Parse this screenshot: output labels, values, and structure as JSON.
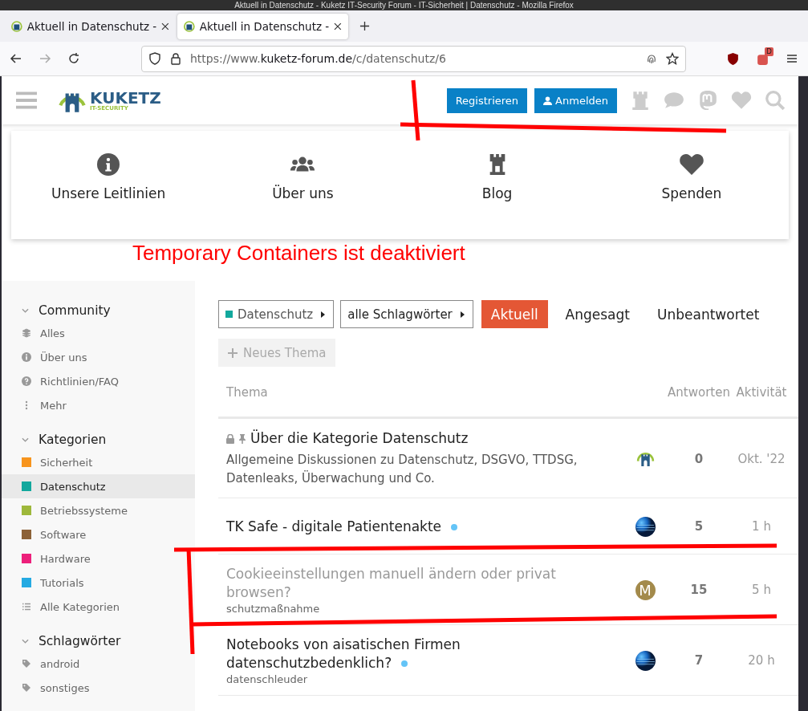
{
  "window": {
    "title": "Aktuell in Datenschutz - Kuketz IT-Security Forum - IT-Sicherheit | Datenschutz - Mozilla Firefox"
  },
  "browser_tabs": [
    {
      "label": "Aktuell in Datenschutz -",
      "selected": false
    },
    {
      "label": "Aktuell in Datenschutz -",
      "selected": true
    }
  ],
  "address_bar": {
    "url_prefix": "https://www.",
    "url_domain": "kuketz-forum.de",
    "url_path": "/c/datenschutz/6",
    "extension_badge": "D"
  },
  "site_header": {
    "logo_text": "KUKETZ",
    "logo_subtext": "IT-SECURITY",
    "buttons": [
      {
        "label": "Registrieren",
        "kind": "signup"
      },
      {
        "label": "Anmelden",
        "kind": "login"
      }
    ]
  },
  "quick_links": [
    {
      "label": "Unsere Leitlinien",
      "kind": "info"
    },
    {
      "label": "Über uns",
      "kind": "users"
    },
    {
      "label": "Blog",
      "kind": "tower"
    },
    {
      "label": "Spenden",
      "kind": "heart"
    }
  ],
  "annotation": {
    "text": "Temporary Containers ist deaktiviert"
  },
  "sidebar": {
    "sections": [
      {
        "title": "Community",
        "expanded": true,
        "items": [
          {
            "label": "Alles",
            "kind": "layers",
            "selected": false
          },
          {
            "label": "Über uns",
            "kind": "info",
            "selected": false
          },
          {
            "label": "Richtlinien/FAQ",
            "kind": "question",
            "selected": false
          },
          {
            "label": "Mehr",
            "kind": "more",
            "selected": false
          }
        ]
      },
      {
        "title": "Kategorien",
        "expanded": true,
        "items": [
          {
            "label": "Sicherheit",
            "kind": "category",
            "color": "#f7941d",
            "selected": false
          },
          {
            "label": "Datenschutz",
            "kind": "category",
            "color": "#12a89d",
            "selected": true
          },
          {
            "label": "Betriebssysteme",
            "kind": "category",
            "color": "#9eb83b",
            "selected": false
          },
          {
            "label": "Software",
            "kind": "category",
            "color": "#8c6238",
            "selected": false
          },
          {
            "label": "Hardware",
            "kind": "category",
            "color": "#ed207b",
            "selected": false
          },
          {
            "label": "Tutorials",
            "kind": "category",
            "color": "#25aae2",
            "selected": false
          },
          {
            "label": "Alle Kategorien",
            "kind": "list",
            "selected": false
          }
        ]
      },
      {
        "title": "Schlagwörter",
        "expanded": true,
        "items": [
          {
            "label": "android",
            "kind": "tag",
            "selected": false
          },
          {
            "label": "sonstiges",
            "kind": "tag",
            "selected": false
          }
        ]
      }
    ]
  },
  "filters": {
    "category": {
      "label": "Datenschutz",
      "color": "#12a89d"
    },
    "tags": {
      "label": "alle Schlagwörter"
    }
  },
  "nav_tabs": [
    {
      "label": "Aktuell",
      "selected": true
    },
    {
      "label": "Angesagt",
      "selected": false
    },
    {
      "label": "Unbeantwortet",
      "selected": false
    }
  ],
  "new_topic_button": {
    "label": "Neues Thema",
    "disabled": true
  },
  "table": {
    "columns": [
      "Thema",
      "Antworten",
      "Aktivität"
    ],
    "rows": [
      {
        "title": "Über die Kategorie Datenschutz",
        "locked": true,
        "pinned": true,
        "visited": false,
        "unread": false,
        "excerpt": "Allgemeine Diskussionen zu Datenschutz, DSGVO, TTDSG, Datenleaks, Überwachung und Co.",
        "avatar": {
          "kind": "logo"
        },
        "replies": "0",
        "activity": "Okt.  '22"
      },
      {
        "title": "TK Safe - digitale Patientenakte",
        "locked": false,
        "pinned": false,
        "visited": false,
        "unread": true,
        "avatar": {
          "kind": "globe"
        },
        "replies": "5",
        "activity": "1 h"
      },
      {
        "title": "Cookieeinstellungen manuell ändern oder privat browsen?",
        "locked": false,
        "pinned": false,
        "visited": true,
        "unread": false,
        "tag": "schutzmaßnahme",
        "avatar": {
          "kind": "letter",
          "letter": "M",
          "color": "#a38a4b"
        },
        "replies": "15",
        "activity": "5 h"
      },
      {
        "title": "Notebooks von aisatischen Firmen datenschutzbedenklich?",
        "locked": false,
        "pinned": false,
        "visited": false,
        "unread": true,
        "tag": "datenschleuder",
        "avatar": {
          "kind": "globe"
        },
        "replies": "7",
        "activity": "20 h"
      }
    ]
  }
}
